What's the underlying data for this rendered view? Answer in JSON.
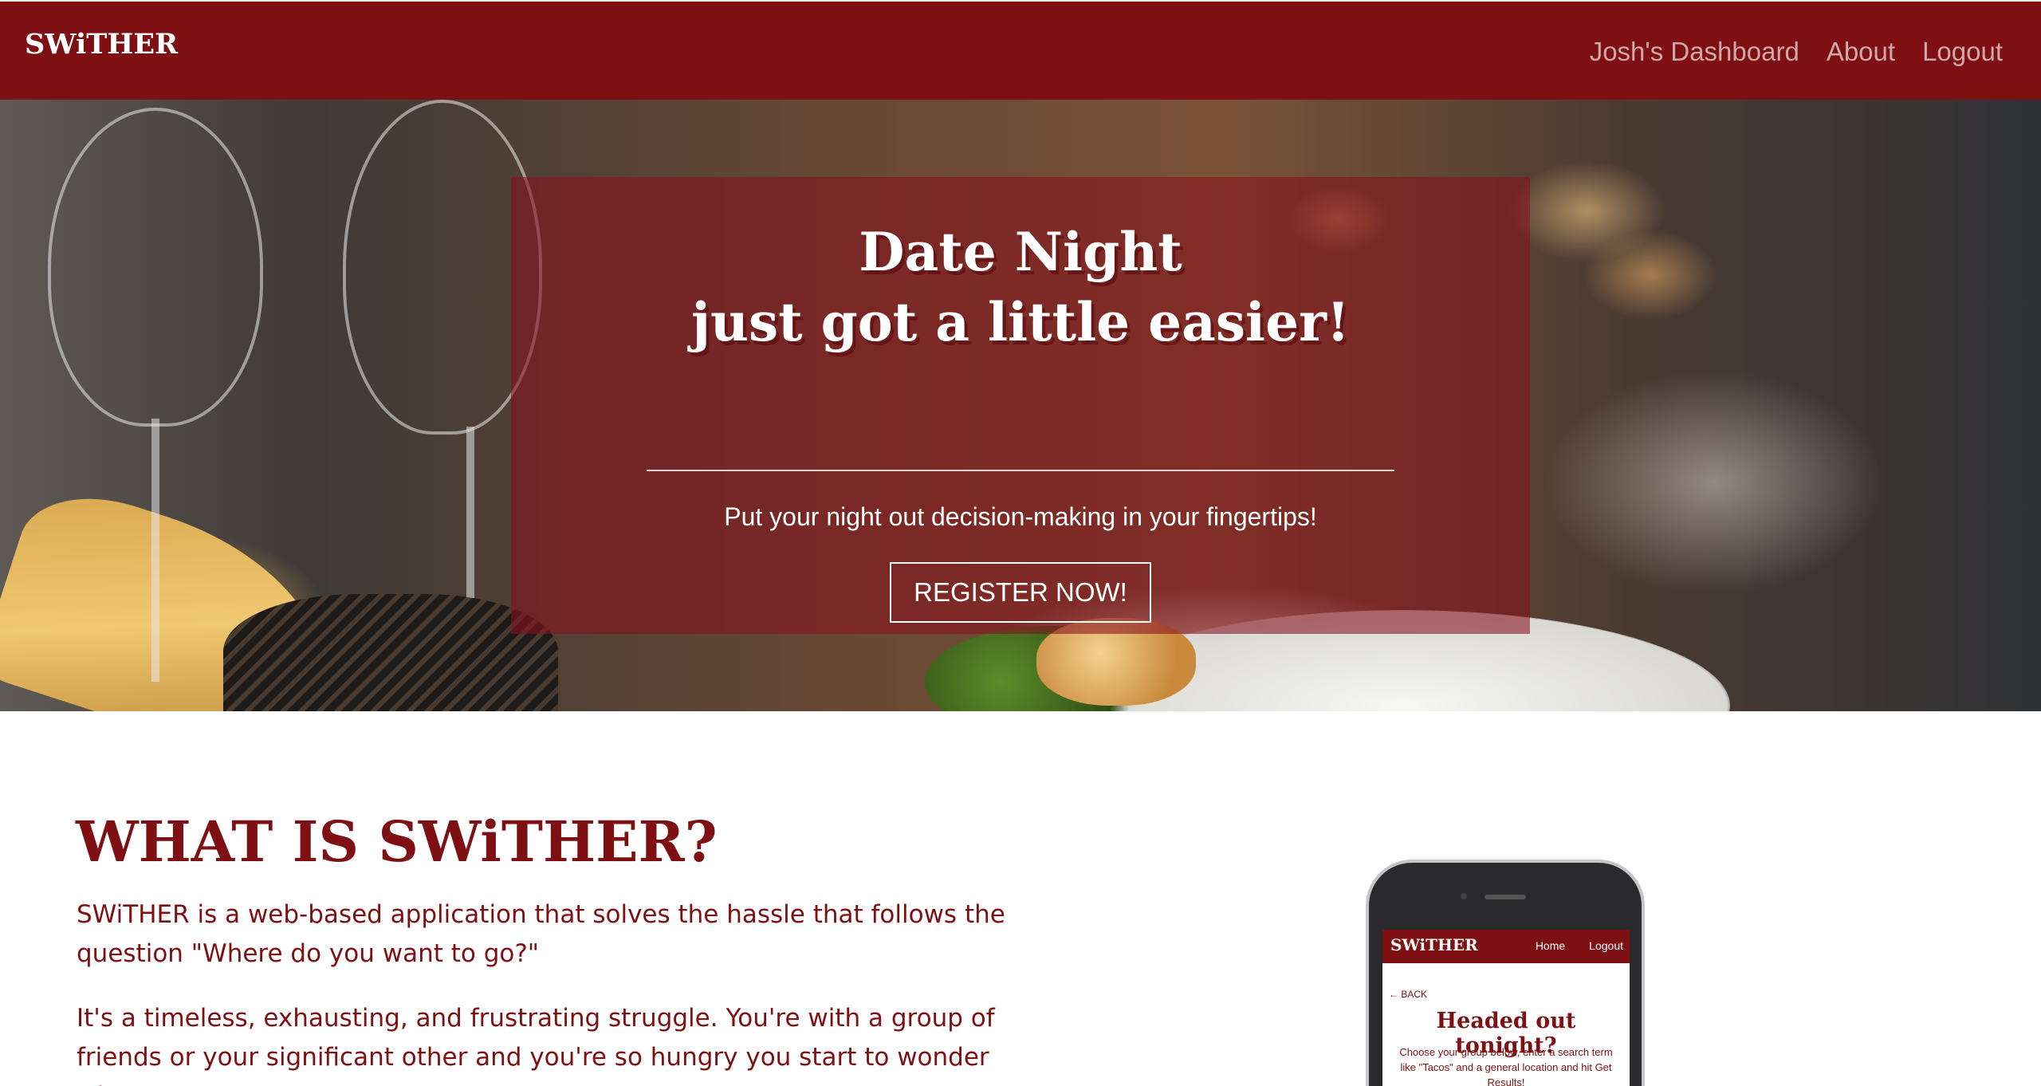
{
  "navbar": {
    "brand": "SWiTHER",
    "links": [
      "Josh's Dashboard",
      "About",
      "Logout"
    ]
  },
  "hero": {
    "title_line1": "Date Night",
    "title_line2": "just got a little easier!",
    "subtitle": "Put your night out decision-making in your fingertips!",
    "cta": "REGISTER NOW!"
  },
  "about": {
    "title": "WHAT IS SWiTHER?",
    "paragraph1": "SWiTHER is a web-based application that solves the hassle that follows the question \"Where do you want to go?\"",
    "paragraph2": "It's a timeless, exhausting, and frustrating struggle. You're with a group of friends or your significant other and you're so hungry you start to wonder what"
  },
  "phone": {
    "brand": "SWiTHER",
    "links": [
      "Home",
      "Logout"
    ],
    "back": "← BACK",
    "title": "Headed out tonight?",
    "text": "Choose your group below, enter a search term like \"Tacos\" and a general location and hit Get Results!"
  },
  "colors": {
    "brand": "#7e0f12",
    "nav_link": "#d2a7a8",
    "hero_overlay": "rgba(135,18,30,0.58)"
  }
}
